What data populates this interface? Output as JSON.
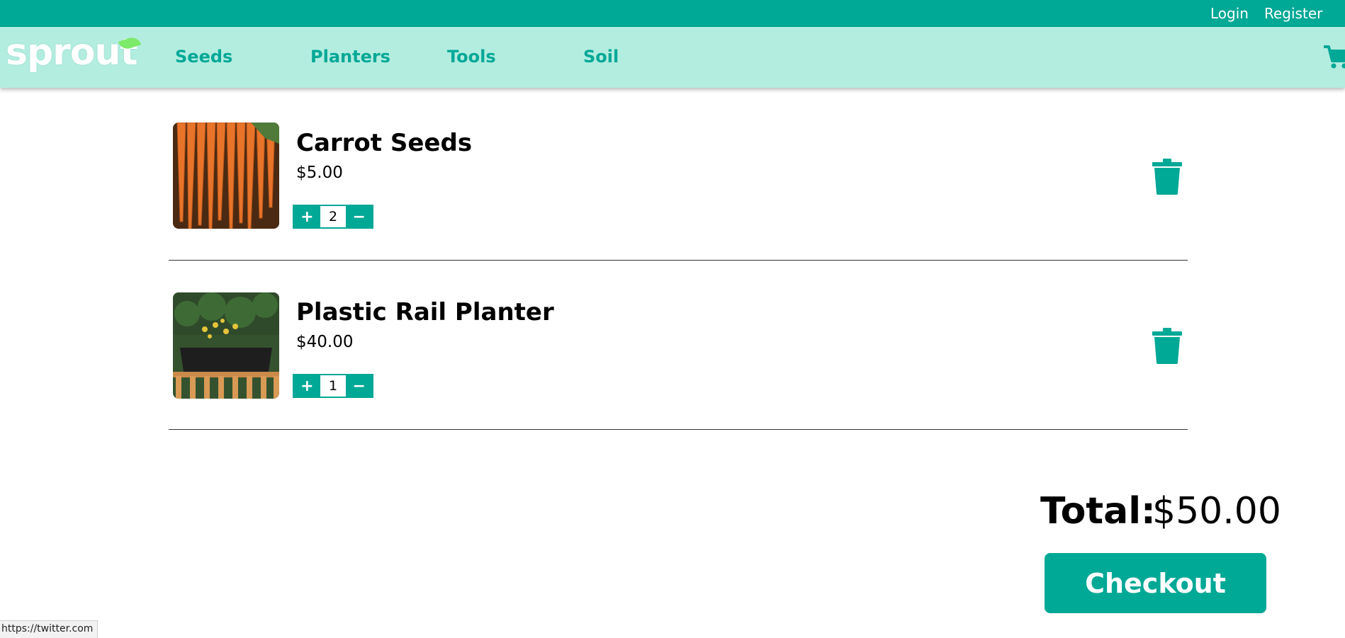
{
  "header": {
    "login_label": "Login",
    "register_label": "Register"
  },
  "nav": {
    "logo_text": "sprout",
    "items": [
      "Seeds",
      "Planters",
      "Tools",
      "Soil"
    ],
    "cart_icon": "cart-icon"
  },
  "cart": {
    "items": [
      {
        "name": "Carrot Seeds",
        "price": "$5.00",
        "quantity": "2",
        "plus": "+",
        "minus": "−",
        "image": "carrots-photo"
      },
      {
        "name": "Plastic Rail Planter",
        "price": "$40.00",
        "quantity": "1",
        "plus": "+",
        "minus": "−",
        "image": "rail-planter-photo"
      }
    ],
    "delete_icon": "trash-icon"
  },
  "summary": {
    "total_label": "Total:",
    "total_value": "$50.00",
    "checkout_label": "Checkout"
  },
  "status_bar": {
    "url": "https://twitter.com"
  },
  "colors": {
    "accent": "#00a896",
    "nav_bg": "#b3ede0",
    "divider": "#333333"
  }
}
